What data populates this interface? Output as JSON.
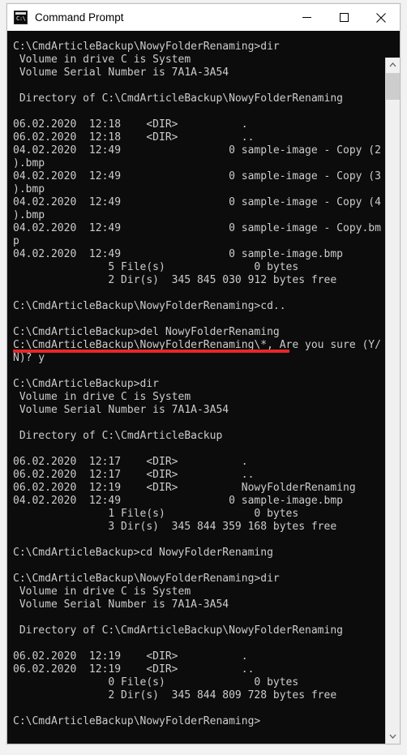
{
  "window": {
    "title": "Command Prompt",
    "icon_name": "cmd-icon",
    "icon_prompt_text": "C:\\",
    "controls": {
      "minimize_label": "Minimize",
      "maximize_label": "Maximize",
      "close_label": "Close"
    }
  },
  "colors": {
    "terminal_background": "#0c0c0c",
    "terminal_foreground": "#cccccc",
    "titlebar_background": "#ffffff",
    "annotation_red": "#e8262a",
    "scrollbar_track": "#f0f0f0",
    "scrollbar_thumb": "#cdcdcd"
  },
  "scrollbar": {
    "up_arrow_name": "scroll-up-arrow",
    "down_arrow_name": "scroll-down-arrow",
    "thumb_name": "scrollbar-thumb"
  },
  "annotation": {
    "type": "red-underline",
    "underlines_line_index": 23,
    "underlined_text": "C:\\CmdArticleBackup>del NowyFolderRenaming"
  },
  "terminal": {
    "prompt_path_1": "C:\\CmdArticleBackup\\NowyFolderRenaming",
    "prompt_path_2": "C:\\CmdArticleBackup",
    "volume_name": "System",
    "volume_serial": "7A1A-3A54",
    "lines": [
      "C:\\CmdArticleBackup\\NowyFolderRenaming>dir",
      " Volume in drive C is System",
      " Volume Serial Number is 7A1A-3A54",
      "",
      " Directory of C:\\CmdArticleBackup\\NowyFolderRenaming",
      "",
      "06.02.2020  12:18    <DIR>          .",
      "06.02.2020  12:18    <DIR>          ..",
      "04.02.2020  12:49                 0 sample-image - Copy (2",
      ").bmp",
      "04.02.2020  12:49                 0 sample-image - Copy (3",
      ").bmp",
      "04.02.2020  12:49                 0 sample-image - Copy (4",
      ").bmp",
      "04.02.2020  12:49                 0 sample-image - Copy.bm",
      "p",
      "04.02.2020  12:49                 0 sample-image.bmp",
      "               5 File(s)              0 bytes",
      "               2 Dir(s)  345 845 030 912 bytes free",
      "",
      "C:\\CmdArticleBackup\\NowyFolderRenaming>cd..",
      "",
      "C:\\CmdArticleBackup>del NowyFolderRenaming",
      "C:\\CmdArticleBackup\\NowyFolderRenaming\\*, Are you sure (Y/",
      "N)? y",
      "",
      "C:\\CmdArticleBackup>dir",
      " Volume in drive C is System",
      " Volume Serial Number is 7A1A-3A54",
      "",
      " Directory of C:\\CmdArticleBackup",
      "",
      "06.02.2020  12:17    <DIR>          .",
      "06.02.2020  12:17    <DIR>          ..",
      "06.02.2020  12:19    <DIR>          NowyFolderRenaming",
      "04.02.2020  12:49                 0 sample-image.bmp",
      "               1 File(s)              0 bytes",
      "               3 Dir(s)  345 844 359 168 bytes free",
      "",
      "C:\\CmdArticleBackup>cd NowyFolderRenaming",
      "",
      "C:\\CmdArticleBackup\\NowyFolderRenaming>dir",
      " Volume in drive C is System",
      " Volume Serial Number is 7A1A-3A54",
      "",
      " Directory of C:\\CmdArticleBackup\\NowyFolderRenaming",
      "",
      "06.02.2020  12:19    <DIR>          .",
      "06.02.2020  12:19    <DIR>          ..",
      "               0 File(s)              0 bytes",
      "               2 Dir(s)  345 844 809 728 bytes free",
      "",
      "C:\\CmdArticleBackup\\NowyFolderRenaming>"
    ]
  }
}
